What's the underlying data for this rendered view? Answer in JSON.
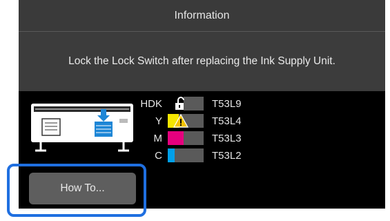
{
  "dialog": {
    "title": "Information",
    "message": "Lock the Lock Switch after replacing the Ink Supply Unit."
  },
  "inks": [
    {
      "label": "HDK",
      "code": "T53L9",
      "color": "#000000",
      "level": 0.45,
      "status_icon": "unlocked-padlock-icon"
    },
    {
      "label": "Y",
      "code": "T53L4",
      "color": "#f4e600",
      "level": 0.3,
      "status_icon": "warning-icon"
    },
    {
      "label": "M",
      "code": "T53L3",
      "color": "#e6007e",
      "level": 0.45
    },
    {
      "label": "C",
      "code": "T53L2",
      "color": "#00a0e9",
      "level": 0.2
    }
  ],
  "buttons": {
    "how_to": "How To..."
  },
  "colors": {
    "highlight": "#1f6fe0",
    "accent_blue": "#1d86d6",
    "panel_bg": "#2a2a2a"
  }
}
